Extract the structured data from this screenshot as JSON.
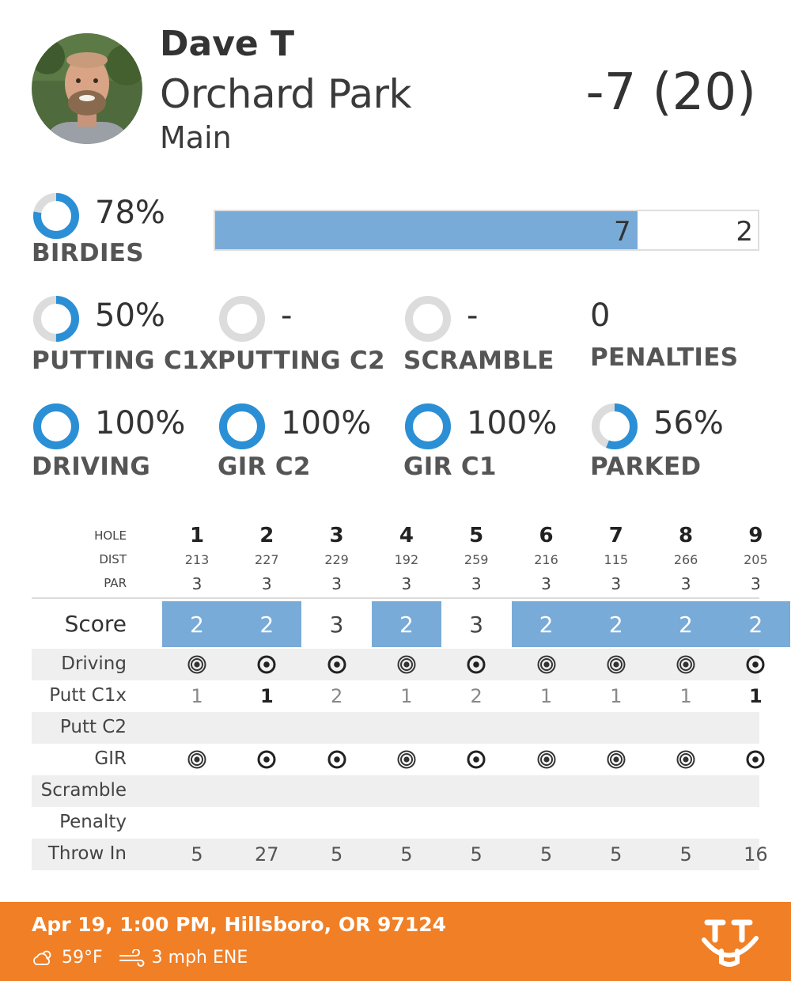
{
  "header": {
    "player_name": "Dave T",
    "course": "Orchard Park",
    "layout": "Main",
    "round_score": "-7 (20)"
  },
  "stats": {
    "birdies": {
      "value": "78%",
      "label": "BIRDIES",
      "pct": 78,
      "bar": {
        "count": 7,
        "other": 2,
        "count_text": "7",
        "other_text": "2"
      }
    },
    "putting_c1x": {
      "value": "50%",
      "label": "PUTTING C1X",
      "pct": 50
    },
    "putting_c2": {
      "value": "-",
      "label": "PUTTING C2",
      "pct": 0
    },
    "scramble": {
      "value": "-",
      "label": "SCRAMBLE",
      "pct": 0
    },
    "penalties": {
      "value": "0",
      "label": "PENALTIES"
    },
    "driving": {
      "value": "100%",
      "label": "DRIVING",
      "pct": 100
    },
    "gir_c2": {
      "value": "100%",
      "label": "GIR C2",
      "pct": 100
    },
    "gir_c1": {
      "value": "100%",
      "label": "GIR C1",
      "pct": 100
    },
    "parked": {
      "value": "56%",
      "label": "PARKED",
      "pct": 56
    }
  },
  "scorecard": {
    "hole_label": "HOLE",
    "dist_label": "DIST",
    "par_label": "PAR",
    "holes": [
      {
        "hole": "1",
        "dist": "213",
        "par": "3",
        "score": "2",
        "birdie": true,
        "driving": "parked",
        "putt_c1x": "1",
        "putt_c1x_style": "light",
        "gir": "parked",
        "throw_in": "5"
      },
      {
        "hole": "2",
        "dist": "227",
        "par": "3",
        "score": "2",
        "birdie": true,
        "driving": "c1",
        "putt_c1x": "1",
        "putt_c1x_style": "bold",
        "gir": "c1",
        "throw_in": "27"
      },
      {
        "hole": "3",
        "dist": "229",
        "par": "3",
        "score": "3",
        "birdie": false,
        "driving": "c1",
        "putt_c1x": "2",
        "putt_c1x_style": "light",
        "gir": "c1",
        "throw_in": "5"
      },
      {
        "hole": "4",
        "dist": "192",
        "par": "3",
        "score": "2",
        "birdie": true,
        "driving": "parked",
        "putt_c1x": "1",
        "putt_c1x_style": "light",
        "gir": "parked",
        "throw_in": "5"
      },
      {
        "hole": "5",
        "dist": "259",
        "par": "3",
        "score": "3",
        "birdie": false,
        "driving": "c1",
        "putt_c1x": "2",
        "putt_c1x_style": "light",
        "gir": "c1",
        "throw_in": "5"
      },
      {
        "hole": "6",
        "dist": "216",
        "par": "3",
        "score": "2",
        "birdie": true,
        "driving": "parked",
        "putt_c1x": "1",
        "putt_c1x_style": "light",
        "gir": "parked",
        "throw_in": "5"
      },
      {
        "hole": "7",
        "dist": "115",
        "par": "3",
        "score": "2",
        "birdie": true,
        "driving": "parked",
        "putt_c1x": "1",
        "putt_c1x_style": "light",
        "gir": "parked",
        "throw_in": "5"
      },
      {
        "hole": "8",
        "dist": "266",
        "par": "3",
        "score": "2",
        "birdie": true,
        "driving": "parked",
        "putt_c1x": "1",
        "putt_c1x_style": "light",
        "gir": "parked",
        "throw_in": "5"
      },
      {
        "hole": "9",
        "dist": "205",
        "par": "3",
        "score": "2",
        "birdie": true,
        "driving": "c1",
        "putt_c1x": "1",
        "putt_c1x_style": "bold",
        "gir": "c1",
        "throw_in": "16"
      }
    ],
    "rows": {
      "score": "Score",
      "driving": "Driving",
      "putt_c1x": "Putt C1x",
      "putt_c2": "Putt C2",
      "gir": "GIR",
      "scramble": "Scramble",
      "penalty": "Penalty",
      "throw_in": "Throw In"
    }
  },
  "footer": {
    "datetime_location": "Apr 19, 1:00 PM, Hillsboro, OR 97124",
    "temperature": "59°F",
    "wind": "3 mph ENE",
    "weather_icon": "cloud-sun-icon",
    "wind_icon": "wind-icon",
    "logo_icon": "udisc-logo"
  },
  "colors": {
    "accent_blue": "#2b8fd6",
    "ring_track": "#dcdcdc",
    "birdie_fill": "#79abd8",
    "footer_orange": "#f07f26"
  }
}
